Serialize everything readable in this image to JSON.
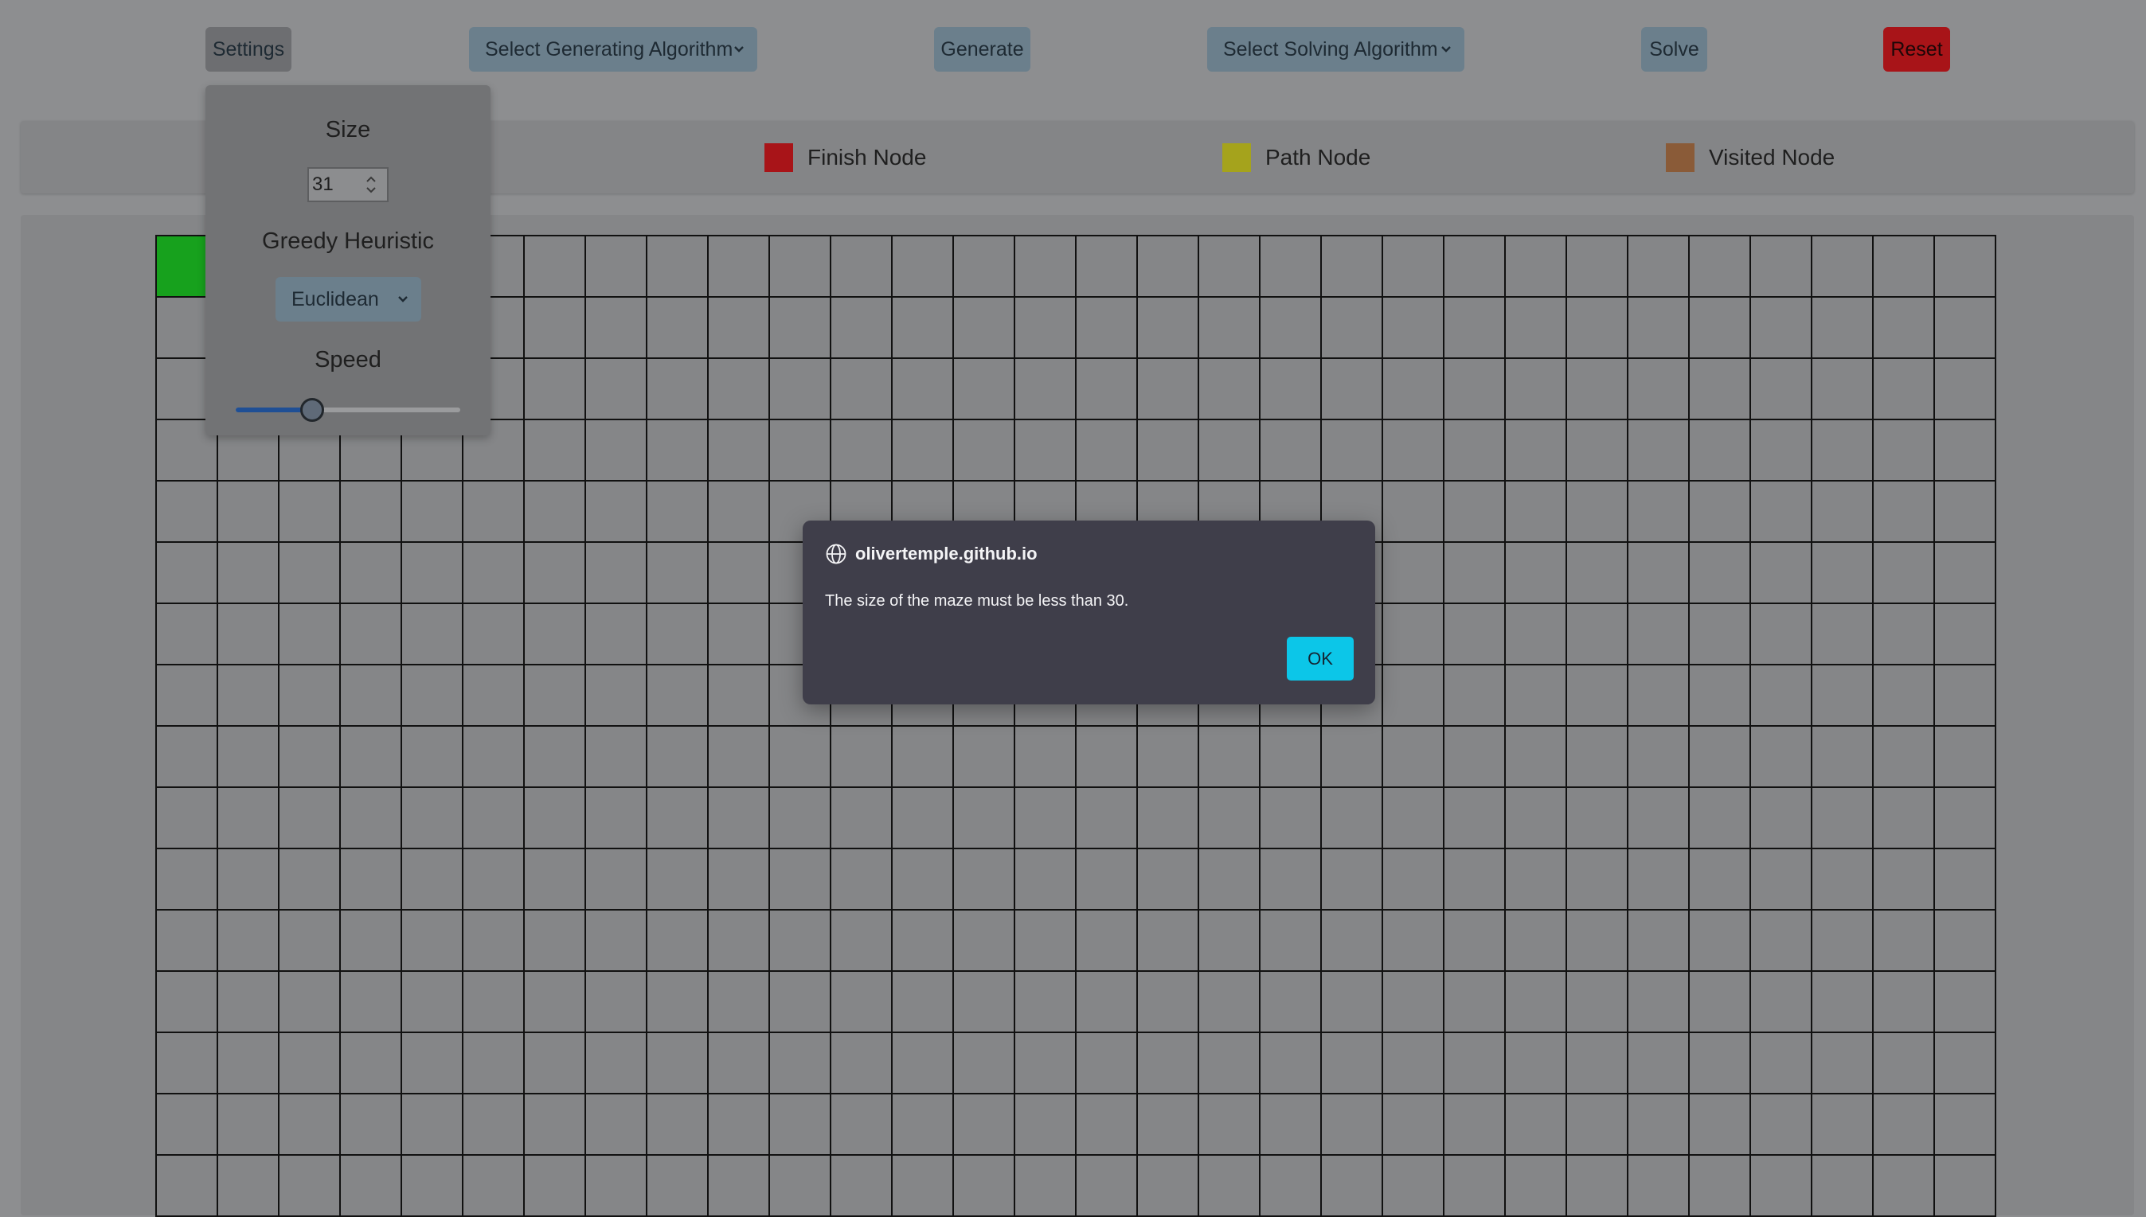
{
  "toolbar": {
    "settings_label": "Settings",
    "generating_select": "Select Generating Algorithm",
    "generate_label": "Generate",
    "solving_select": "Select Solving Algorithm",
    "solve_label": "Solve",
    "reset_label": "Reset"
  },
  "legend": [
    {
      "label": "Finish Node",
      "color": "#a81418"
    },
    {
      "label": "Path Node",
      "color": "#a5a31c"
    },
    {
      "label": "Visited Node",
      "color": "#8a5b38"
    }
  ],
  "settings": {
    "size_label": "Size",
    "size_value": "31",
    "heuristic_label": "Greedy Heuristic",
    "heuristic_value": "Euclidean",
    "speed_label": "Speed",
    "speed_fraction": 0.34
  },
  "maze": {
    "visible_cols": 30,
    "visible_rows": 16,
    "start_color": "#17a11d"
  },
  "dialog": {
    "origin": "olivertemple.github.io",
    "message": "The size of the maze must be less than 30.",
    "ok_label": "OK"
  }
}
